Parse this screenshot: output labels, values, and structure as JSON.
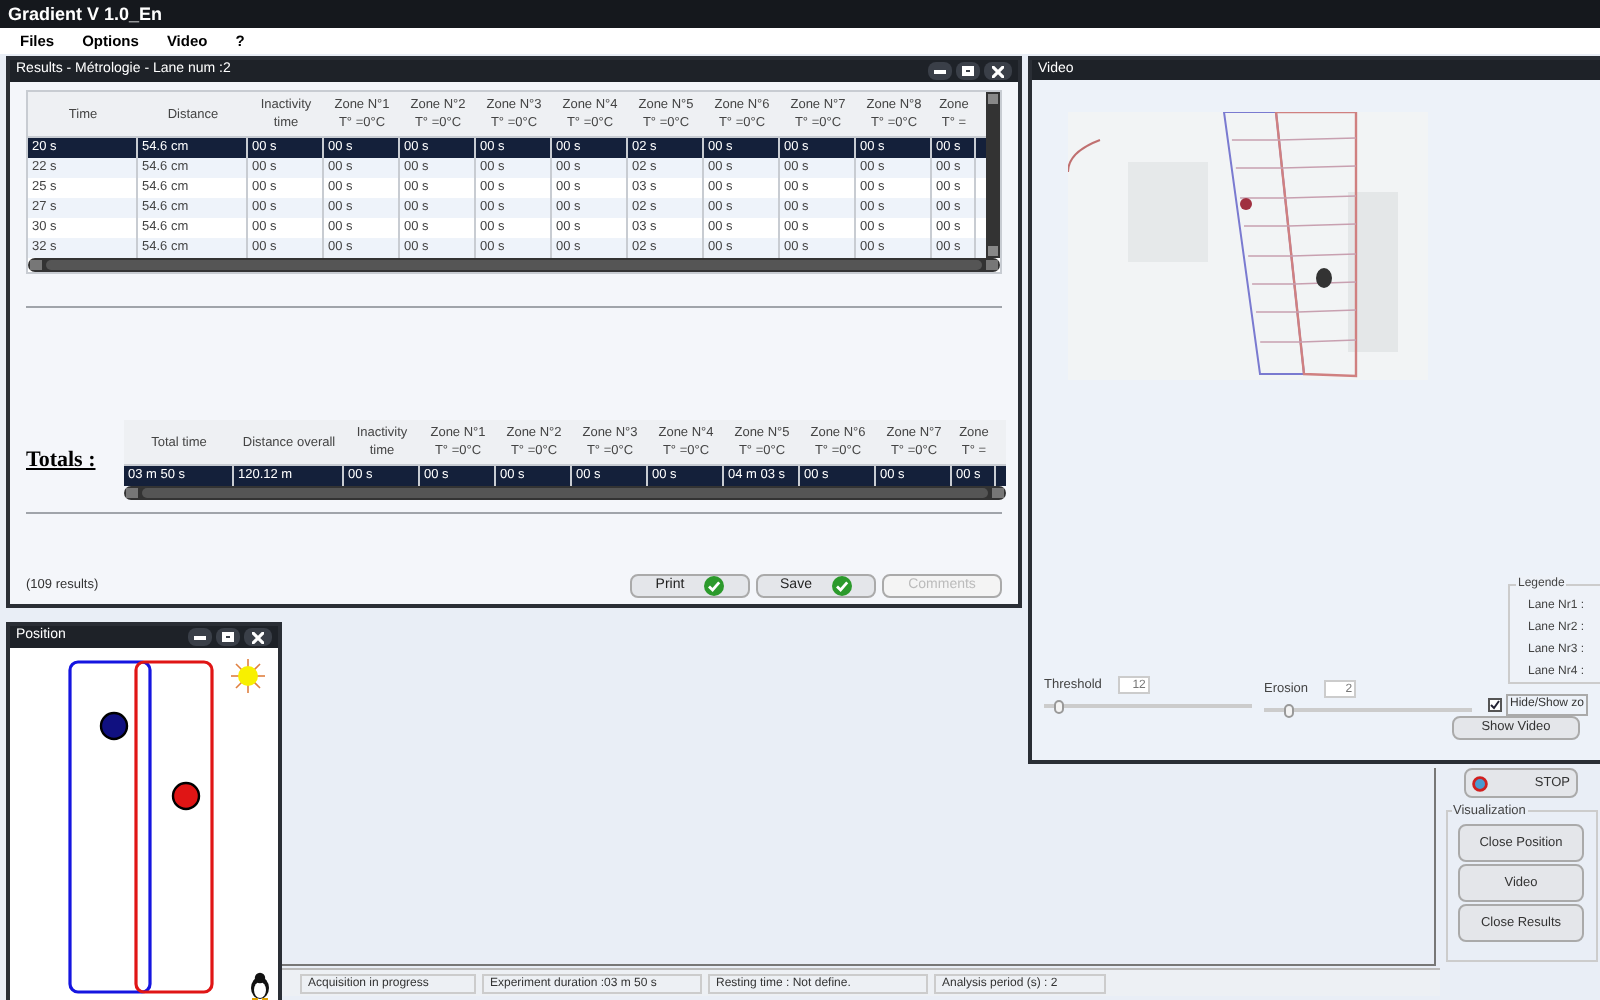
{
  "app": {
    "title": "Gradient V 1.0_En"
  },
  "menu": [
    "Files",
    "Options",
    "Video",
    "?"
  ],
  "results": {
    "title": "Results - Métrologie - Lane num :2",
    "columns": [
      {
        "label": "Time"
      },
      {
        "label": "Distance"
      },
      {
        "label": "Inactivity time"
      },
      {
        "label": "Zone N°1",
        "unit": "T° =0°C"
      },
      {
        "label": "Zone N°2",
        "unit": "T° =0°C"
      },
      {
        "label": "Zone N°3",
        "unit": "T° =0°C"
      },
      {
        "label": "Zone N°4",
        "unit": "T° =0°C"
      },
      {
        "label": "Zone N°5",
        "unit": "T° =0°C"
      },
      {
        "label": "Zone N°6",
        "unit": "T° =0°C"
      },
      {
        "label": "Zone N°7",
        "unit": "T° =0°C"
      },
      {
        "label": "Zone N°8",
        "unit": "T° =0°C"
      },
      {
        "label": "Zone",
        "unit": "T° ="
      }
    ],
    "rows": [
      {
        "selected": true,
        "cells": [
          "20 s",
          "54.6 cm",
          "00 s",
          "00 s",
          "00 s",
          "00 s",
          "00 s",
          "02 s",
          "00 s",
          "00 s",
          "00 s",
          "00 s"
        ]
      },
      {
        "selected": false,
        "cells": [
          "22 s",
          "54.6 cm",
          "00 s",
          "00 s",
          "00 s",
          "00 s",
          "00 s",
          "02 s",
          "00 s",
          "00 s",
          "00 s",
          "00 s"
        ]
      },
      {
        "selected": false,
        "cells": [
          "25 s",
          "54.6 cm",
          "00 s",
          "00 s",
          "00 s",
          "00 s",
          "00 s",
          "03 s",
          "00 s",
          "00 s",
          "00 s",
          "00 s"
        ]
      },
      {
        "selected": false,
        "cells": [
          "27 s",
          "54.6 cm",
          "00 s",
          "00 s",
          "00 s",
          "00 s",
          "00 s",
          "02 s",
          "00 s",
          "00 s",
          "00 s",
          "00 s"
        ]
      },
      {
        "selected": false,
        "cells": [
          "30 s",
          "54.6 cm",
          "00 s",
          "00 s",
          "00 s",
          "00 s",
          "00 s",
          "03 s",
          "00 s",
          "00 s",
          "00 s",
          "00 s"
        ]
      },
      {
        "selected": false,
        "cells": [
          "32 s",
          "54.6 cm",
          "00 s",
          "00 s",
          "00 s",
          "00 s",
          "00 s",
          "02 s",
          "00 s",
          "00 s",
          "00 s",
          "00 s"
        ]
      }
    ],
    "totals_label": "Totals :",
    "totals_columns": [
      {
        "label": "Total time"
      },
      {
        "label": "Distance overall"
      },
      {
        "label": "Inactivity time"
      },
      {
        "label": "Zone N°1",
        "unit": "T° =0°C"
      },
      {
        "label": "Zone N°2",
        "unit": "T° =0°C"
      },
      {
        "label": "Zone N°3",
        "unit": "T° =0°C"
      },
      {
        "label": "Zone N°4",
        "unit": "T° =0°C"
      },
      {
        "label": "Zone N°5",
        "unit": "T° =0°C"
      },
      {
        "label": "Zone N°6",
        "unit": "T° =0°C"
      },
      {
        "label": "Zone N°7",
        "unit": "T° =0°C"
      },
      {
        "label": "Zone",
        "unit": "T° ="
      }
    ],
    "totals_row": {
      "selected": true,
      "cells": [
        "03 m 50 s",
        "120.12 m",
        "00 s",
        "00 s",
        "00 s",
        "00 s",
        "00 s",
        "04 m 03 s",
        "00 s",
        "00 s",
        "00 s"
      ]
    },
    "count": "(109 results)",
    "buttons": [
      {
        "label": "Print",
        "disabled": false
      },
      {
        "label": "Save",
        "disabled": false
      },
      {
        "label": "Comments",
        "disabled": true
      }
    ]
  },
  "video": {
    "title": "Video",
    "legend": {
      "title": "Legende",
      "lanes": [
        "Lane Nr1 :",
        "Lane Nr2 :",
        "Lane Nr3 :",
        "Lane Nr4 :"
      ]
    },
    "sliders": [
      {
        "label": "Threshold",
        "value": "12",
        "level": 0.05
      },
      {
        "label": "Erosion",
        "value": "2",
        "level": 0.1
      }
    ],
    "checkbox": {
      "label": "Hide/Show zo",
      "checked": true
    },
    "button": "Show Video"
  },
  "controls": {
    "stop": "STOP",
    "group": "Visualization",
    "buttons": [
      "Close Position",
      "Video",
      "Close Results"
    ]
  },
  "position": {
    "title": "Position"
  },
  "status_bar": [
    "Acquisition in progress",
    "Experiment duration :03 m 50 s",
    "Resting time :  Not define.",
    "Analysis period (s) : 2"
  ]
}
